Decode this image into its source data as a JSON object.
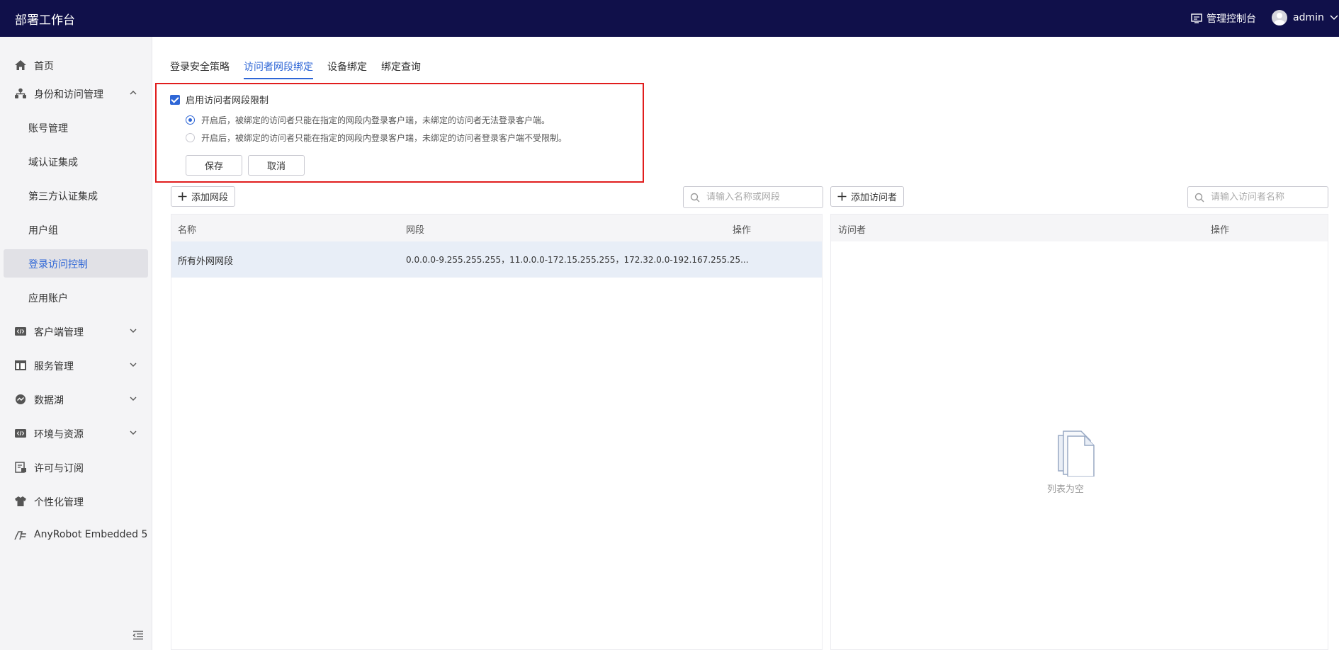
{
  "app": {
    "title": "部署工作台"
  },
  "topbar": {
    "console_label": "管理控制台",
    "user_name": "admin"
  },
  "sidebar": {
    "items": [
      {
        "label": "首页",
        "icon": "home-icon"
      },
      {
        "label": "身份和访问管理",
        "icon": "org-icon",
        "expanded": true
      },
      {
        "label": "账号管理"
      },
      {
        "label": "域认证集成"
      },
      {
        "label": "第三方认证集成"
      },
      {
        "label": "用户组"
      },
      {
        "label": "登录访问控制",
        "active": true
      },
      {
        "label": "应用账户"
      },
      {
        "label": "客户端管理",
        "icon": "code-icon"
      },
      {
        "label": "服务管理",
        "icon": "layout-icon"
      },
      {
        "label": "数据湖",
        "icon": "datalake-icon"
      },
      {
        "label": "环境与资源",
        "icon": "code-icon"
      },
      {
        "label": "许可与订阅",
        "icon": "license-icon"
      },
      {
        "label": "个性化管理",
        "icon": "shirt-icon"
      },
      {
        "label": "AnyRobot Embedded 5",
        "icon": "anyrobot-icon"
      }
    ]
  },
  "tabs": [
    "登录安全策略",
    "访问者网段绑定",
    "设备绑定",
    "绑定查询"
  ],
  "active_tab": "访问者网段绑定",
  "restriction": {
    "enabled_label": "启用访问者网段限制",
    "enabled": true,
    "options": [
      {
        "label": "开启后，被绑定的访问者只能在指定的网段内登录客户端，未绑定的访问者无法登录客户端。",
        "selected": true
      },
      {
        "label": "开启后，被绑定的访问者只能在指定的网段内登录客户端，未绑定的访问者登录客户端不受限制。",
        "selected": false
      }
    ],
    "save_label": "保存",
    "cancel_label": "取消"
  },
  "segments": {
    "add_label": "添加网段",
    "search_placeholder": "请输入名称或网段",
    "columns": [
      "名称",
      "网段",
      "操作"
    ],
    "rows": [
      {
        "name": "所有外网网段",
        "range": "0.0.0.0-9.255.255.255，11.0.0.0-172.15.255.255，172.32.0.0-192.167.255.25..."
      }
    ]
  },
  "visitors": {
    "add_label": "添加访问者",
    "search_placeholder": "请输入访问者名称",
    "columns": [
      "访问者",
      "操作"
    ],
    "empty_text": "列表为空"
  },
  "colors": {
    "topbar": "#10104a",
    "accent": "#2e66d6",
    "highlight": "#e11d1d"
  }
}
